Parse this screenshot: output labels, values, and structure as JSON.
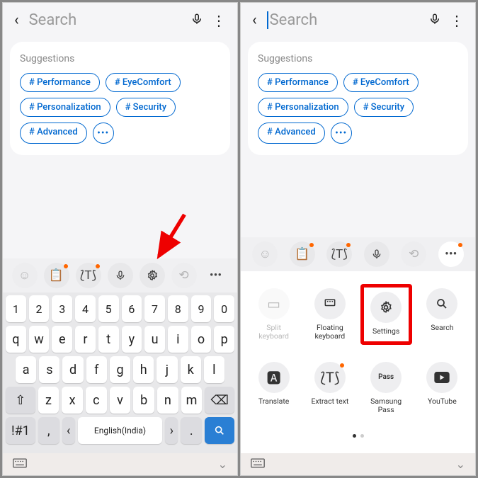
{
  "search_placeholder": "Search",
  "suggestions_title": "Suggestions",
  "chips": [
    "Performance",
    "EyeComfort",
    "Personalization",
    "Security",
    "Advanced"
  ],
  "number_row": [
    "1",
    "2",
    "3",
    "4",
    "5",
    "6",
    "7",
    "8",
    "9",
    "0"
  ],
  "row1": [
    "q",
    "w",
    "e",
    "r",
    "t",
    "y",
    "u",
    "i",
    "o",
    "p"
  ],
  "row2": [
    "a",
    "s",
    "d",
    "f",
    "g",
    "h",
    "j",
    "k",
    "l"
  ],
  "row3": [
    "z",
    "x",
    "c",
    "v",
    "b",
    "n",
    "m"
  ],
  "symkey": "!#1",
  "comma": ",",
  "space": "English(India)",
  "period": ".",
  "grid": {
    "split": "Split keyboard",
    "floating": "Floating keyboard",
    "settings": "Settings",
    "search": "Search",
    "translate": "Translate",
    "extract": "Extract text",
    "pass": "Samsung Pass",
    "youtube": "YouTube"
  }
}
